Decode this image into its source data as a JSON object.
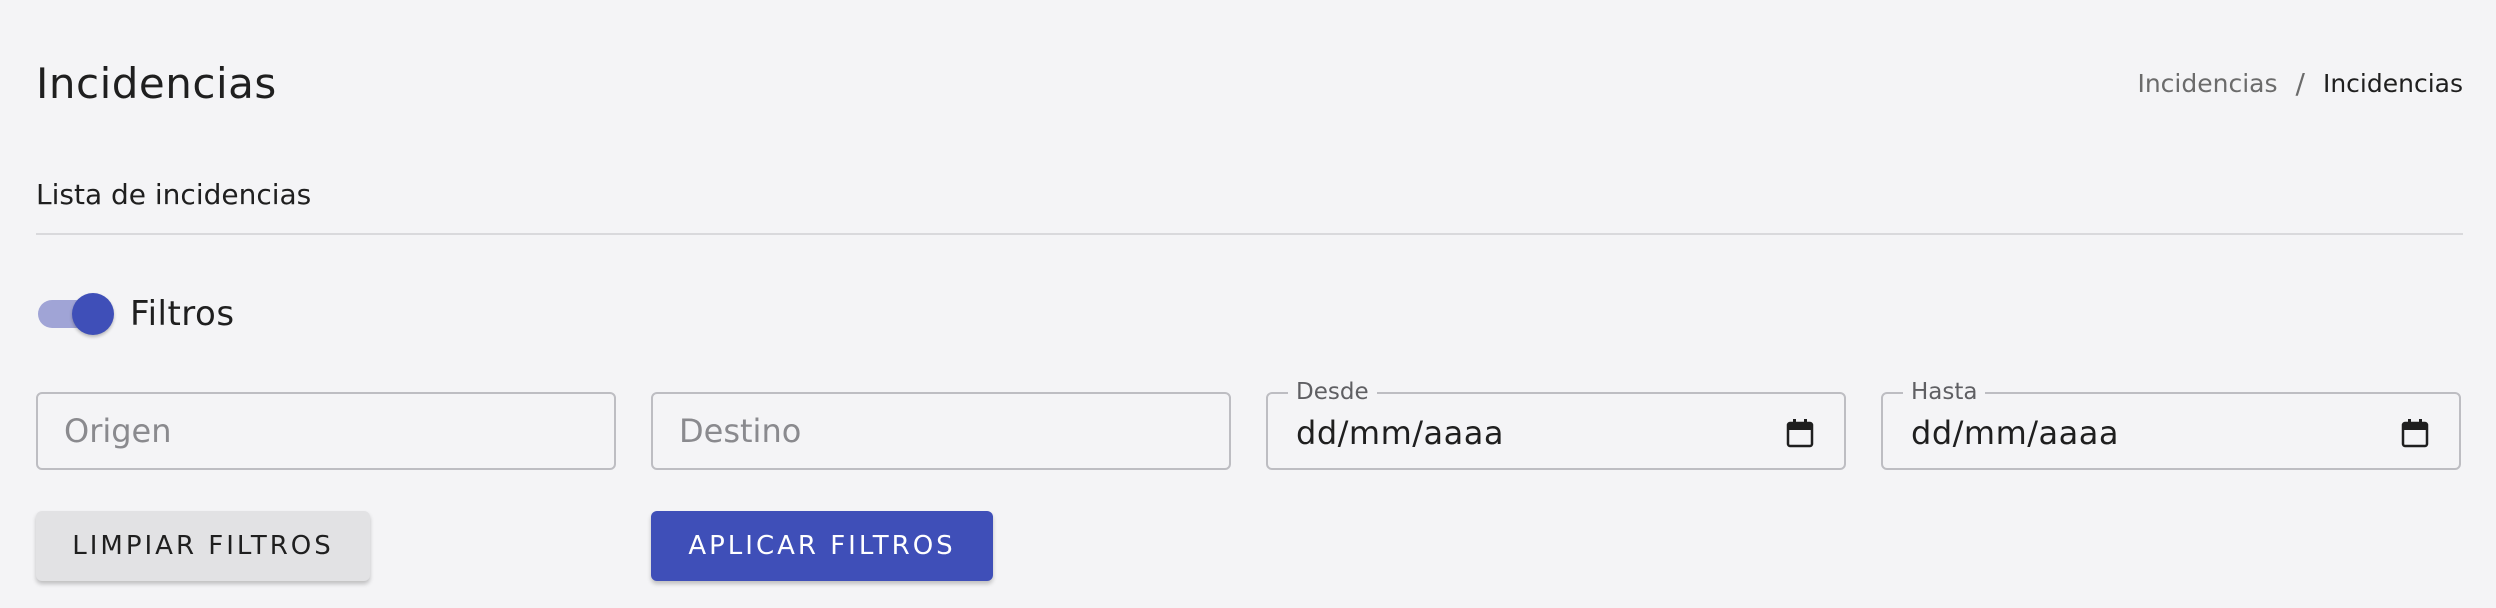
{
  "header": {
    "title": "Incidencias",
    "breadcrumb": {
      "link": "Incidencias",
      "separator": "/",
      "current": "Incidencias"
    }
  },
  "section": {
    "title": "Lista de incidencias"
  },
  "filters": {
    "toggle_label": "Filtros",
    "toggle_on": true,
    "origen_placeholder": "Origen",
    "destino_placeholder": "Destino",
    "desde_label": "Desde",
    "desde_value": "dd/mm/aaaa",
    "hasta_label": "Hasta",
    "hasta_value": "dd/mm/aaaa",
    "clear_label": "LIMPIAR FILTROS",
    "apply_label": "APLICAR FILTROS"
  },
  "icons": {
    "calendar": "calendar-icon"
  },
  "colors": {
    "accent": "#3f4fb8",
    "accent_light": "#a0a4d6",
    "background": "#f4f4f6"
  }
}
